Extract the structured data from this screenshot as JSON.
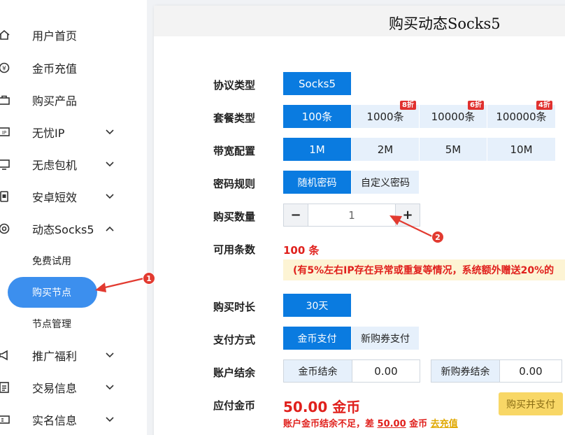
{
  "sidebar": {
    "items": [
      {
        "label": "用户首页",
        "icon": "home-icon",
        "chevron": false
      },
      {
        "label": "金币充值",
        "icon": "coin-recharge-icon",
        "chevron": false
      },
      {
        "label": "购买产品",
        "icon": "briefcase-icon",
        "chevron": false
      },
      {
        "label": "无忧IP",
        "icon": "ip-icon",
        "chevron": true
      },
      {
        "label": "无虑包机",
        "icon": "monitor-icon",
        "chevron": true
      },
      {
        "label": "安卓短效",
        "icon": "android-phone-icon",
        "chevron": true
      },
      {
        "label": "动态Socks5",
        "icon": "target-icon",
        "chevron": true,
        "expanded": true
      }
    ],
    "subitems": [
      "免费试用",
      "购买节点",
      "节点管理"
    ],
    "active_subitem": "购买节点",
    "lower_items": [
      {
        "label": "推广福利",
        "icon": "megaphone-icon"
      },
      {
        "label": "交易信息",
        "icon": "list-icon"
      },
      {
        "label": "实名信息",
        "icon": "id-card-icon"
      }
    ]
  },
  "main": {
    "title": "购买动态Socks5",
    "protocol": {
      "label": "协议类型",
      "options": [
        "Socks5"
      ],
      "selected": "Socks5"
    },
    "package": {
      "label": "套餐类型",
      "options": [
        {
          "text": "100条",
          "badge": ""
        },
        {
          "text": "1000条",
          "badge": "8折"
        },
        {
          "text": "10000条",
          "badge": "6折"
        },
        {
          "text": "100000条",
          "badge": "4折"
        }
      ],
      "selected": "100条"
    },
    "bandwidth": {
      "label": "带宽配置",
      "options": [
        "1M",
        "2M",
        "5M",
        "10M"
      ],
      "selected": "1M"
    },
    "password": {
      "label": "密码规则",
      "options": [
        "随机密码",
        "自定义密码"
      ],
      "selected": "随机密码"
    },
    "quantity": {
      "label": "购买数量",
      "value": "1",
      "minus": "−",
      "plus": "+"
    },
    "available": {
      "label": "可用条数",
      "value": "100 条"
    },
    "notice": "(有5%左右IP存在异常或重复等情况，系统额外赠送20%的",
    "duration": {
      "label": "购买时长",
      "options": [
        "30天"
      ],
      "selected": "30天"
    },
    "payment": {
      "label": "支付方式",
      "options": [
        "金币支付",
        "新购券支付"
      ],
      "selected": "金币支付"
    },
    "balance": {
      "label": "账户结余",
      "coin_label": "金币结余",
      "coin_value": "0.00",
      "voucher_label": "新购券结余",
      "voucher_value": "0.00"
    },
    "pay": {
      "label": "应付金币",
      "amount": "50.00 金币",
      "button": "购买并支付"
    },
    "warning": {
      "prefix": "账户金币结余不足，差 ",
      "diff": "50.00",
      "unit": " 金币 ",
      "link": "去充值"
    }
  },
  "annotations": {
    "marker1": "1",
    "marker2": "2"
  },
  "colors": {
    "primary": "#0a7be0",
    "active_nav": "#3c8fee",
    "light_blue": "#e6f0fb",
    "red": "#e0201c",
    "badge": "#e0312f",
    "pay_button": "#f8d766",
    "notice_bg": "#fdf4d4"
  }
}
